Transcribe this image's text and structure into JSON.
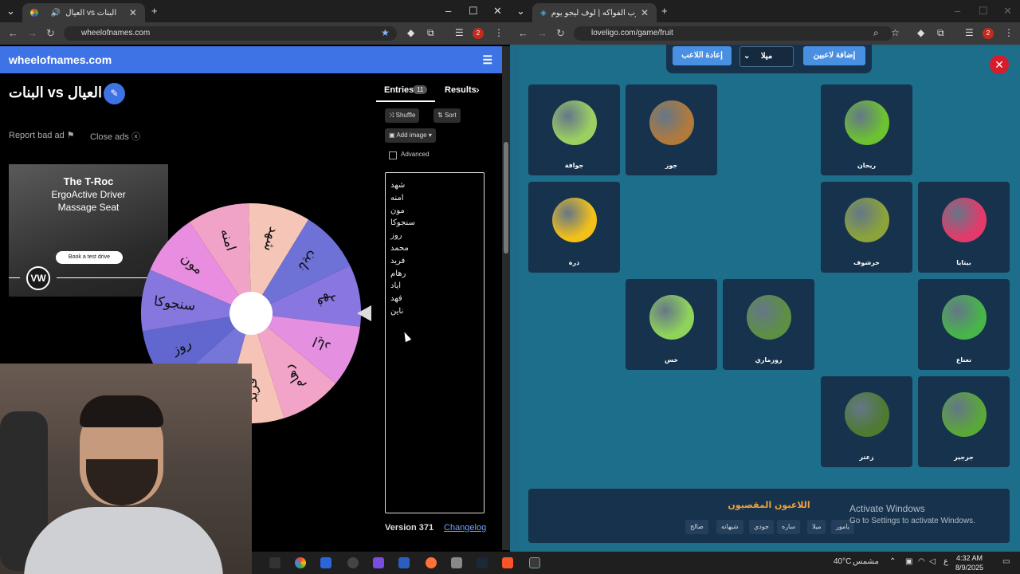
{
  "left_browser": {
    "tab_title": "العيال vs البنات",
    "url": "wheelofnames.com",
    "notification_count": "2"
  },
  "wheel_site": {
    "brand": "wheelofnames.com",
    "wheel_title": "البنات vs العيال",
    "report_ad": "Report bad ad",
    "close_ads": "Close ads",
    "ad": {
      "headline": "The T-Roc",
      "line1": "ErgoActive Driver",
      "line2": "Massage Seat",
      "cta": "Book a test drive",
      "logo": "VW"
    },
    "wheel_segments": [
      "مون",
      "امنه",
      "شهد",
      "ناين",
      "فهد",
      "اياد",
      "رهام",
      "فريد",
      "محمد",
      "روز",
      "سنجوكا"
    ],
    "wheel_colors": [
      "#e88de0",
      "#f0a3c7",
      "#f5c5b8",
      "#6e71d6",
      "#8a76e0",
      "#e48fe0",
      "#f2a4c8",
      "#f5c4b7",
      "#7576d8",
      "#6267cf",
      "#8577dd"
    ],
    "tabs": {
      "entries": "Entries",
      "entries_count": "11",
      "results": "Results"
    },
    "shuffle": "Shuffle",
    "sort": "Sort",
    "add_image": "Add image",
    "advanced": "Advanced",
    "entries": [
      "شهد",
      "امنه",
      "مون",
      "سنجوكا",
      "روز",
      "محمد",
      "فريد",
      "رهام",
      "اياد",
      "فهد",
      "ناين"
    ],
    "version": "Version 371",
    "changelog": "Changelog"
  },
  "right_browser": {
    "tab_title": "لعبة حرب الفواكه | لوف ليجو يوم",
    "url": "loveligo.com/game/fruit",
    "notification_count": "2"
  },
  "game": {
    "add_players": "إضافة لاعبين",
    "player_select": "ميلا",
    "reset_player": "إعادة اللاعب",
    "cards": [
      {
        "label": "جوافة",
        "color": "#9ccf62"
      },
      {
        "label": "جوز",
        "color": "#b07a3c"
      },
      {
        "label": "ريحان",
        "color": "#6cc230"
      },
      {
        "label": "ذرة",
        "color": "#f2c019"
      },
      {
        "label": "خرشوف",
        "color": "#8aa33a"
      },
      {
        "label": "بيتايا",
        "color": "#e23b6b"
      },
      {
        "label": "خس",
        "color": "#8fd35b"
      },
      {
        "label": "روزماري",
        "color": "#5d8f45"
      },
      {
        "label": "نعناع",
        "color": "#47b54a"
      },
      {
        "label": "زعتر",
        "color": "#4e7a32"
      },
      {
        "label": "جرجير",
        "color": "#5aa73a"
      }
    ],
    "eliminated_title": "اللاعبون المقصيون",
    "eliminated": [
      "يامور",
      "ميلا",
      "ساره",
      "جودي",
      "شيهانه",
      "صالح"
    ],
    "activate_title": "Activate Windows",
    "activate_sub": "Go to Settings to activate Windows."
  },
  "taskbar": {
    "weather": "40°C",
    "weather_label": "مشمس",
    "lang": "ع",
    "time": "4:32 AM",
    "date": "8/9/2025"
  }
}
